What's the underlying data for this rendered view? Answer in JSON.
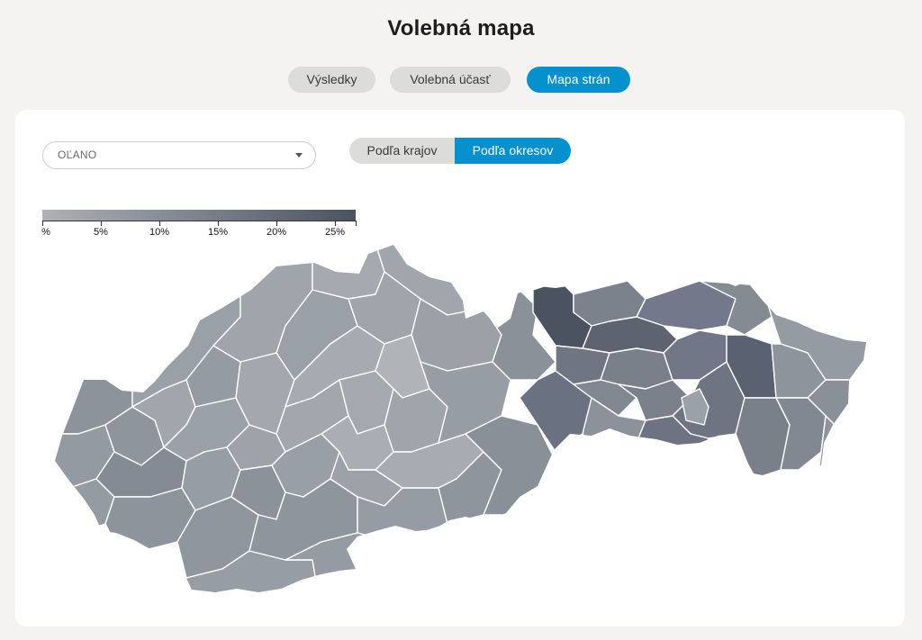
{
  "page": {
    "title": "Volebná mapa"
  },
  "tabs": [
    {
      "label": "Výsledky",
      "active": false
    },
    {
      "label": "Volebná účasť",
      "active": false
    },
    {
      "label": "Mapa strán",
      "active": true
    }
  ],
  "party_select": {
    "value": "OĽANO"
  },
  "view_toggle": {
    "options": [
      {
        "label": "Podľa krajov",
        "active": false
      },
      {
        "label": "Podľa okresov",
        "active": true
      }
    ]
  },
  "legend": {
    "ticks": [
      "%",
      "5%",
      "10%",
      "15%",
      "20%",
      "25%"
    ],
    "color_min": "#aeb1b6",
    "color_max": "#4c5360"
  },
  "colors": {
    "accent": "#0591cd",
    "tab_inactive": "#dcdcdb",
    "background": "#f4f3f2",
    "district_border": "#ffffff"
  }
}
